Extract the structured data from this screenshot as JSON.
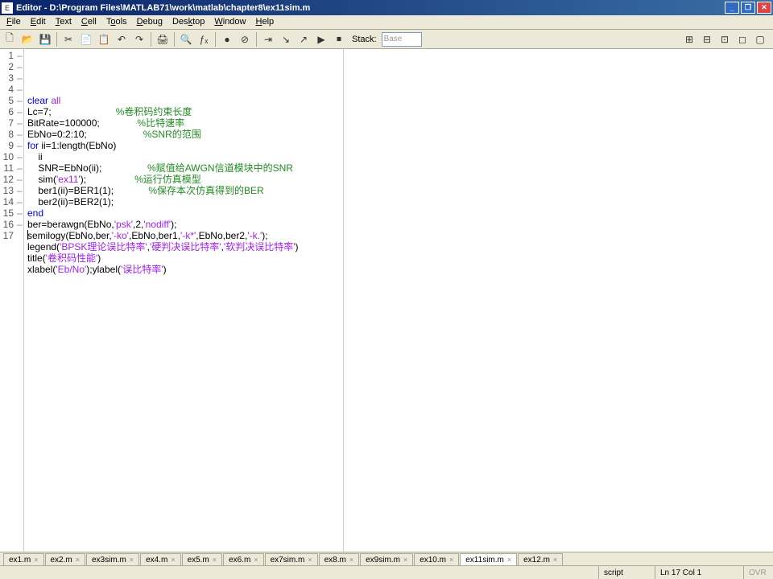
{
  "titlebar": {
    "title": "Editor - D:\\Program Files\\MATLAB71\\work\\matlab\\chapter8\\ex11sim.m"
  },
  "menu": {
    "file": "File",
    "edit": "Edit",
    "text": "Text",
    "cell": "Cell",
    "tools": "Tools",
    "debug": "Debug",
    "desktop": "Desktop",
    "window": "Window",
    "help": "Help"
  },
  "toolbar": {
    "new": "🗋",
    "open": "📂",
    "save": "💾",
    "cut": "✂",
    "copy": "📄",
    "paste": "📋",
    "undo": "↶",
    "redo": "↷",
    "print": "🖨",
    "find": "🔍",
    "fx": "ƒₓ",
    "bp": "●",
    "clearbp": "⊘",
    "step": "⇥",
    "stepin": "↘",
    "stepout": "↗",
    "run": "▶",
    "exit": "⏹",
    "stack": "Stack:",
    "base": "Base",
    "tile1": "⊞",
    "tile2": "⊟",
    "tile3": "⊡",
    "tile4": "◻",
    "tile5": "▢"
  },
  "code": {
    "lines": [
      {
        "n": 1,
        "dash": true,
        "segs": [
          [
            "kw",
            "clear "
          ],
          [
            "str",
            "all"
          ]
        ]
      },
      {
        "n": 2,
        "dash": true,
        "segs": [
          [
            "txt",
            "Lc=7;                        "
          ],
          [
            "cmt",
            "%卷积码约束长度"
          ]
        ]
      },
      {
        "n": 3,
        "dash": true,
        "segs": [
          [
            "txt",
            "BitRate=100000;              "
          ],
          [
            "cmt",
            "%比特速率"
          ]
        ]
      },
      {
        "n": 4,
        "dash": true,
        "segs": [
          [
            "txt",
            "EbNo=0:2:10;                     "
          ],
          [
            "cmt",
            "%SNR的范围"
          ]
        ]
      },
      {
        "n": 5,
        "dash": true,
        "segs": [
          [
            "kw",
            "for "
          ],
          [
            "txt",
            "ii=1:length(EbNo)"
          ]
        ]
      },
      {
        "n": 6,
        "dash": true,
        "segs": [
          [
            "txt",
            "    ii"
          ]
        ]
      },
      {
        "n": 7,
        "dash": true,
        "segs": [
          [
            "txt",
            "    SNR=EbNo(ii);                 "
          ],
          [
            "cmt",
            "%赋值给AWGN信道模块中的SNR"
          ]
        ]
      },
      {
        "n": 8,
        "dash": true,
        "segs": [
          [
            "txt",
            "    sim("
          ],
          [
            "str",
            "'ex11'"
          ],
          [
            "txt",
            ");                  "
          ],
          [
            "cmt",
            "%运行仿真模型"
          ]
        ]
      },
      {
        "n": 9,
        "dash": true,
        "segs": [
          [
            "txt",
            "    ber1(ii)=BER1(1);             "
          ],
          [
            "cmt",
            "%保存本次仿真得到的BER"
          ]
        ]
      },
      {
        "n": 10,
        "dash": true,
        "segs": [
          [
            "txt",
            "    ber2(ii)=BER2(1);"
          ]
        ]
      },
      {
        "n": 11,
        "dash": true,
        "segs": [
          [
            "kw",
            "end"
          ]
        ]
      },
      {
        "n": 12,
        "dash": true,
        "segs": [
          [
            "txt",
            "ber=berawgn(EbNo,"
          ],
          [
            "str",
            "'psk'"
          ],
          [
            "txt",
            ",2,"
          ],
          [
            "str",
            "'nodiff'"
          ],
          [
            "txt",
            ");"
          ]
        ]
      },
      {
        "n": 13,
        "dash": true,
        "segs": [
          [
            "txt",
            "semilogy(EbNo,ber,"
          ],
          [
            "str",
            "'-ko'"
          ],
          [
            "txt",
            ",EbNo,ber1,"
          ],
          [
            "str",
            "'-k*'"
          ],
          [
            "txt",
            ",EbNo,ber2,"
          ],
          [
            "str",
            "'-k.'"
          ],
          [
            "txt",
            ");"
          ]
        ]
      },
      {
        "n": 14,
        "dash": true,
        "segs": [
          [
            "txt",
            "legend("
          ],
          [
            "str",
            "'BPSK理论误比特率'"
          ],
          [
            "txt",
            ","
          ],
          [
            "str",
            "'硬判决误比特率'"
          ],
          [
            "txt",
            ","
          ],
          [
            "str",
            "'软判决误比特率'"
          ],
          [
            "txt",
            ")"
          ]
        ]
      },
      {
        "n": 15,
        "dash": true,
        "segs": [
          [
            "txt",
            "title("
          ],
          [
            "str",
            "'卷积码性能'"
          ],
          [
            "txt",
            ")"
          ]
        ]
      },
      {
        "n": 16,
        "dash": true,
        "segs": [
          [
            "txt",
            "xlabel("
          ],
          [
            "str",
            "'Eb/No'"
          ],
          [
            "txt",
            ");ylabel("
          ],
          [
            "str",
            "'误比特率'"
          ],
          [
            "txt",
            ")"
          ]
        ]
      },
      {
        "n": 17,
        "dash": false,
        "segs": []
      }
    ]
  },
  "tabs": [
    {
      "label": "ex1.m",
      "active": false
    },
    {
      "label": "ex2.m",
      "active": false
    },
    {
      "label": "ex3sim.m",
      "active": false
    },
    {
      "label": "ex4.m",
      "active": false
    },
    {
      "label": "ex5.m",
      "active": false
    },
    {
      "label": "ex6.m",
      "active": false
    },
    {
      "label": "ex7sim.m",
      "active": false
    },
    {
      "label": "ex8.m",
      "active": false
    },
    {
      "label": "ex9sim.m",
      "active": false
    },
    {
      "label": "ex10.m",
      "active": false
    },
    {
      "label": "ex11sim.m",
      "active": true
    },
    {
      "label": "ex12.m",
      "active": false
    }
  ],
  "status": {
    "type": "script",
    "pos": "Ln  17  Col  1",
    "ovr": "OVR"
  }
}
